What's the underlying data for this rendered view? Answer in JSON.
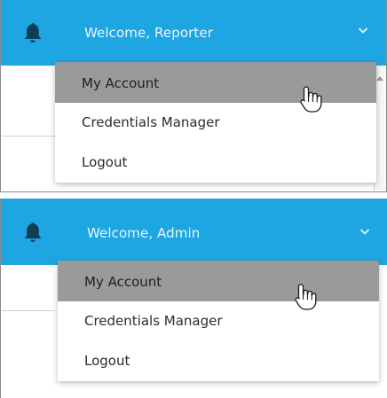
{
  "panels": [
    {
      "header": {
        "welcome_text": "Welcome, Reporter",
        "bell_icon": "bell-icon",
        "chevron_icon": "chevron-down-icon"
      },
      "menu": {
        "items": [
          {
            "label": "My Account",
            "highlighted": true
          },
          {
            "label": "Credentials Manager",
            "highlighted": false
          },
          {
            "label": "Logout",
            "highlighted": false
          }
        ]
      }
    },
    {
      "header": {
        "welcome_text": "Welcome, Admin",
        "bell_icon": "bell-icon",
        "chevron_icon": "chevron-down-icon"
      },
      "menu": {
        "items": [
          {
            "label": "My Account",
            "highlighted": true
          },
          {
            "label": "Credentials Manager",
            "highlighted": false
          },
          {
            "label": "Logout",
            "highlighted": false
          }
        ]
      }
    }
  ],
  "colors": {
    "header_background": "#1ea6e3",
    "header_text": "#eaf6fd",
    "bell_icon": "#0f3f55",
    "highlight_background": "#9a9a9a"
  }
}
